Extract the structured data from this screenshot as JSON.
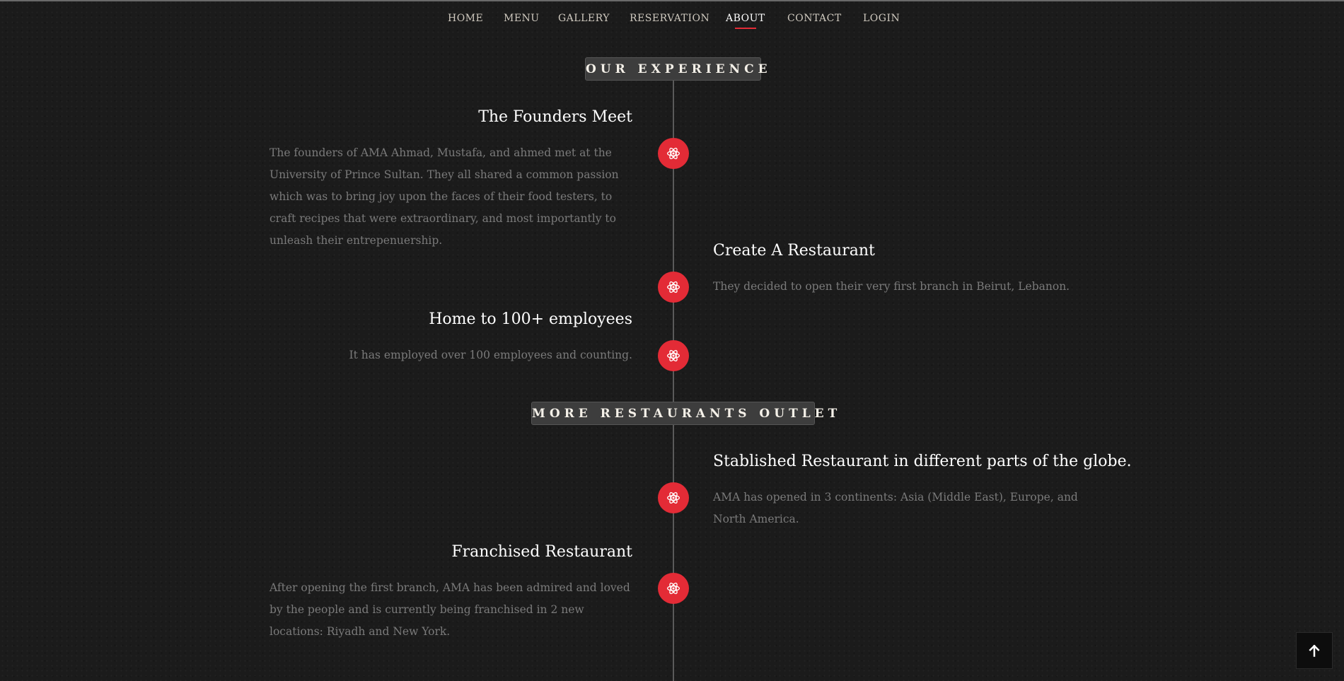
{
  "nav": {
    "items": [
      {
        "label": "HOME"
      },
      {
        "label": "MENU"
      },
      {
        "label": "GALLERY"
      },
      {
        "label": "RESERVATION"
      },
      {
        "label": "ABOUT",
        "active": true
      },
      {
        "label": "CONTACT"
      },
      {
        "label": "LOGIN"
      }
    ]
  },
  "sections": {
    "experience": {
      "label": "OUR EXPERIENCE"
    },
    "outlets": {
      "label": "MORE RESTAURANTS OUTLET"
    }
  },
  "timeline": [
    {
      "title": "The Founders Meet",
      "text": "The founders of AMA Ahmad, Mustafa, and ahmed met at the University of Prince Sultan. They all shared a common passion which was to bring joy upon the faces of their food testers, to craft recipes that were extraordinary, and most importantly to unleash their entrepenuership.",
      "icon": "atom-icon"
    },
    {
      "title": "Create A Restaurant",
      "text": "They decided to open their very first branch in Beirut, Lebanon.",
      "icon": "atom-icon"
    },
    {
      "title": "Home to 100+ employees",
      "text": "It has employed over 100 employees and counting.",
      "icon": "atom-icon"
    },
    {
      "title": "Stablished Restaurant in different parts of the globe.",
      "text": "AMA has opened in 3 continents: Asia (Middle East), Europe, and North America.",
      "icon": "atom-icon"
    },
    {
      "title": "Franchised Restaurant",
      "text": "After opening the first branch, AMA has been admired and loved by the people and is currently being franchised in 2 new locations: Riyadh and New York.",
      "icon": "atom-icon"
    }
  ],
  "scroll_top": {
    "icon": "arrow-up-icon"
  },
  "colors": {
    "accent": "#e32b36",
    "background": "#1b1b1b",
    "heading": "#ffffff",
    "body_text": "#7a7a7a",
    "label_bg": "#3d3d3d"
  }
}
